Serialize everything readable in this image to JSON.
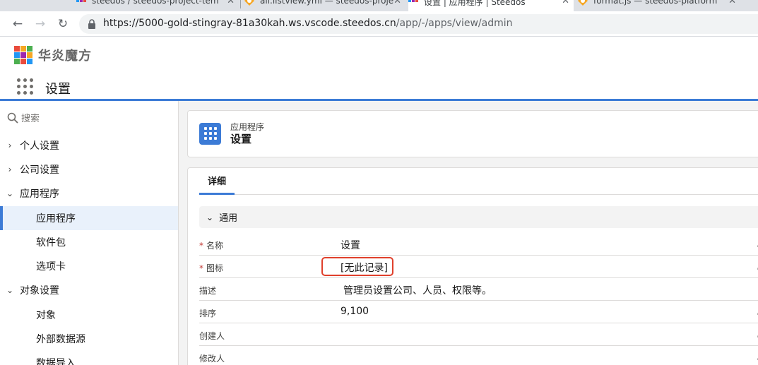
{
  "browser": {
    "tabs": [
      {
        "title": "steedos / steedos-project-tem",
        "active": false
      },
      {
        "title": "all.listview.yml — steedos-proje",
        "active": false
      },
      {
        "title": "设置 | 应用程序 | Steedos",
        "active": true
      },
      {
        "title": "format.js — steedos-platform",
        "active": false
      }
    ],
    "url_host": "https://5000-gold-stingray-81a30kah.ws.vscode.steedos.cn",
    "url_path": "/app/-/apps/view/admin"
  },
  "header": {
    "logo_text": "华炎魔方",
    "app_name": "设置"
  },
  "sidebar": {
    "search_placeholder": "搜索",
    "groups": [
      {
        "label": "个人设置",
        "expanded": false
      },
      {
        "label": "公司设置",
        "expanded": false
      },
      {
        "label": "应用程序",
        "expanded": true
      },
      {
        "label": "对象设置",
        "expanded": true
      }
    ],
    "items": [
      "应用程序",
      "软件包",
      "选项卡",
      "对象",
      "外部数据源",
      "数据导入"
    ]
  },
  "record": {
    "type": "应用程序",
    "title": "设置",
    "tab_detail": "详细",
    "section_general": "通用",
    "fields": [
      {
        "label": "名称",
        "value": "设置",
        "required": true
      },
      {
        "label": "图标",
        "value": "[无此记录]",
        "required": true
      },
      {
        "label": "描述",
        "value": "管理员设置公司、人员、权限等。",
        "required": false
      },
      {
        "label": "排序",
        "value": "9,100",
        "required": false
      },
      {
        "label": "创建人",
        "value": "",
        "required": false
      },
      {
        "label": "修改人",
        "value": "",
        "required": false
      }
    ],
    "required_mark": "*"
  },
  "colors": {
    "brand_blue": "#3c7bd6",
    "highlight_red": "#e0402c"
  }
}
